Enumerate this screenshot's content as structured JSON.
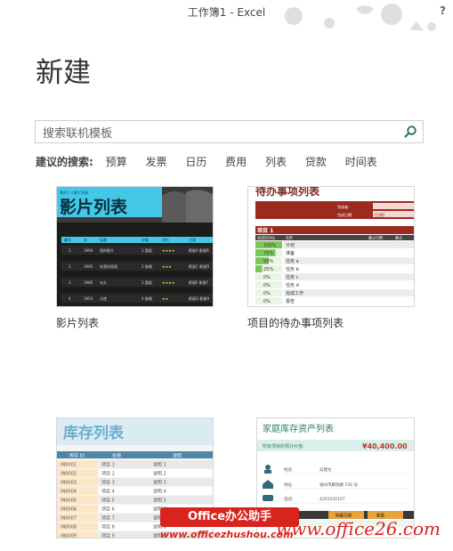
{
  "window": {
    "title": "工作簿1 - Excel",
    "help": "?"
  },
  "page": {
    "heading": "新建"
  },
  "search": {
    "placeholder": "搜索联机模板"
  },
  "suggested": {
    "label": "建议的搜索:",
    "items": [
      "预算",
      "发票",
      "日历",
      "费用",
      "列表",
      "贷款",
      "时间表"
    ]
  },
  "templates": [
    {
      "label": "影片列表",
      "preview": {
        "small_title": "我的个人影片列表",
        "title": "影片列表",
        "headers": [
          "编号",
          "年",
          "标题",
          "评级",
          "评价",
          "主演"
        ],
        "rows": [
          [
            "1",
            "1994",
            "我的影片",
            "1 喜剧",
            "★★★★",
            "影星A 影星B"
          ],
          [
            "2",
            "1995",
            "失落的家园",
            "2 剧情",
            "★★★",
            "影星C 影星D"
          ],
          [
            "3",
            "1980",
            "长久",
            "3 喜剧",
            "★★★★",
            "影星E 影星F"
          ],
          [
            "4",
            "1954",
            "天使",
            "4 剧情",
            "★★",
            "影星G 影星H"
          ]
        ]
      }
    },
    {
      "label": "项目的待办事项列表",
      "preview": {
        "title": "待办事项列表",
        "fields": [
          "完成者:",
          "完成日期:",
          "[日期]"
        ],
        "section": "项目 1",
        "headers": [
          "完成百分比",
          "任务",
          "截止日期",
          "备注"
        ],
        "rows": [
          {
            "pct": "100%",
            "fill": 1.0,
            "task": "计划"
          },
          {
            "pct": "75%",
            "fill": 0.75,
            "task": "准备"
          },
          {
            "pct": "50%",
            "fill": 0.5,
            "task": "任务 a"
          },
          {
            "pct": "25%",
            "fill": 0.25,
            "task": "任务 b"
          },
          {
            "pct": "0%",
            "fill": 0,
            "task": "任务 c"
          },
          {
            "pct": "0%",
            "fill": 0,
            "task": "任务 d"
          },
          {
            "pct": "0%",
            "fill": 0,
            "task": "完成工作"
          },
          {
            "pct": "0%",
            "fill": 0,
            "task": "报告"
          }
        ]
      }
    },
    {
      "label": "库存列表",
      "preview": {
        "title": "库存列表",
        "headers": [
          "库存 ID",
          "名称",
          "说明"
        ],
        "rows": [
          [
            "IN0001",
            "项目 1",
            "说明 1"
          ],
          [
            "IN0002",
            "项目 2",
            "说明 2"
          ],
          [
            "IN0003",
            "项目 3",
            "说明 3"
          ],
          [
            "IN0004",
            "项目 4",
            "说明 4"
          ],
          [
            "IN0005",
            "项目 5",
            "说明 5"
          ],
          [
            "IN0006",
            "项目 6",
            "说明 6"
          ],
          [
            "IN0007",
            "项目 7",
            "说明 7"
          ],
          [
            "IN0008",
            "项目 8",
            "说明 8"
          ],
          [
            "IN0009",
            "项目 9",
            "说明 9"
          ]
        ]
      }
    },
    {
      "label": "家庭库存资产列表",
      "preview": {
        "title": "家庭库存资产列表",
        "total_label": "所有项目的预计价值:",
        "total_value": "¥40,400.00",
        "info": [
          {
            "key": "姓名:",
            "value": "吴建文"
          },
          {
            "key": "地址:",
            "value": "福州市解放路 156 号"
          },
          {
            "key": "电话:",
            "value": "4355550107"
          }
        ],
        "table_headers": [
          "购置日期",
          "数量"
        ]
      }
    }
  ],
  "watermark": {
    "badge": "Office办公助手",
    "url": "www.officezhushou.com",
    "brand": "www.office26.com"
  },
  "colors": {
    "accent_green": "#217346",
    "movie_cyan": "#44c8e8",
    "todo_red": "#9c2b1f",
    "inventory_blue": "#6aaed3"
  }
}
